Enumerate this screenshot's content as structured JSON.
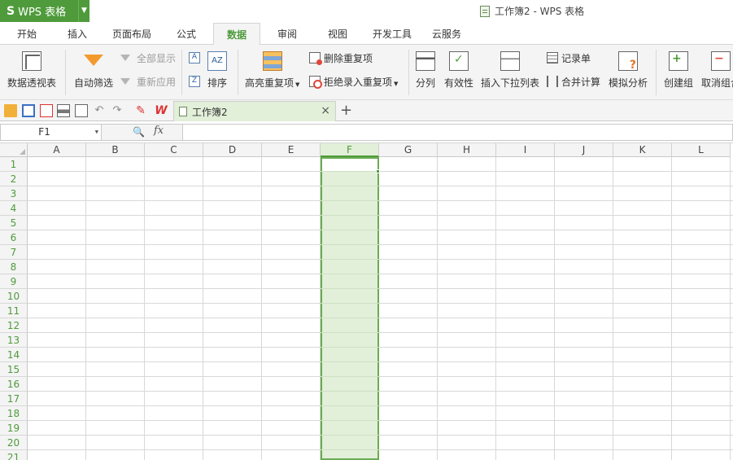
{
  "app": {
    "logo": "S",
    "name": "WPS 表格",
    "window_title": "工作簿2 - WPS 表格"
  },
  "menu": {
    "tabs": [
      {
        "label": "开始"
      },
      {
        "label": "插入"
      },
      {
        "label": "页面布局"
      },
      {
        "label": "公式"
      },
      {
        "label": "数据"
      },
      {
        "label": "审阅"
      },
      {
        "label": "视图"
      },
      {
        "label": "开发工具"
      },
      {
        "label": "云服务"
      }
    ],
    "active_tab": "数据"
  },
  "ribbon": {
    "pivot": "数据透视表",
    "autofilter": "自动筛选",
    "show_all": "全部显示",
    "reapply": "重新应用",
    "sort": "排序",
    "highlight_dup": "高亮重复项",
    "remove_dup": "删除重复项",
    "reject_dup": "拒绝录入重复项",
    "split": "分列",
    "validity": "有效性",
    "insert_dropdown": "插入下拉列表",
    "record": "记录单",
    "consolidate": "合并计算",
    "whatif": "模拟分析",
    "group": "创建组",
    "ungroup": "取消组合"
  },
  "doc_tab": {
    "title": "工作簿2",
    "close": "×",
    "new": "+"
  },
  "formula_bar": {
    "name_box": "F1",
    "fx": "fx",
    "value": ""
  },
  "grid": {
    "columns": [
      "A",
      "B",
      "C",
      "D",
      "E",
      "F",
      "G",
      "H",
      "I",
      "J",
      "K",
      "L"
    ],
    "rows": [
      "1",
      "2",
      "3",
      "4",
      "5",
      "6",
      "7",
      "8",
      "9",
      "10",
      "11",
      "12",
      "13",
      "14",
      "15",
      "16",
      "17",
      "18",
      "19",
      "20",
      "21"
    ],
    "selected_column": "F",
    "active_cell": "F1"
  },
  "colors": {
    "accent": "#4f9b3c",
    "selection_fill": "#e2efd9",
    "highlight_orange": "#f39a2e"
  },
  "icons": [
    "app-logo-icon",
    "pivot-table-icon",
    "filter-icon",
    "sort-icon",
    "highlight-icon",
    "delete-duplicates-icon",
    "reject-duplicates-icon",
    "split-column-icon",
    "validity-icon",
    "dropdown-list-icon",
    "record-form-icon",
    "consolidate-icon",
    "what-if-icon",
    "group-icon",
    "ungroup-icon",
    "open-icon",
    "save-icon",
    "pdf-icon",
    "print-icon",
    "preview-icon",
    "undo-icon",
    "redo-icon",
    "format-painter-icon",
    "wps-icon",
    "zoom-icon"
  ]
}
